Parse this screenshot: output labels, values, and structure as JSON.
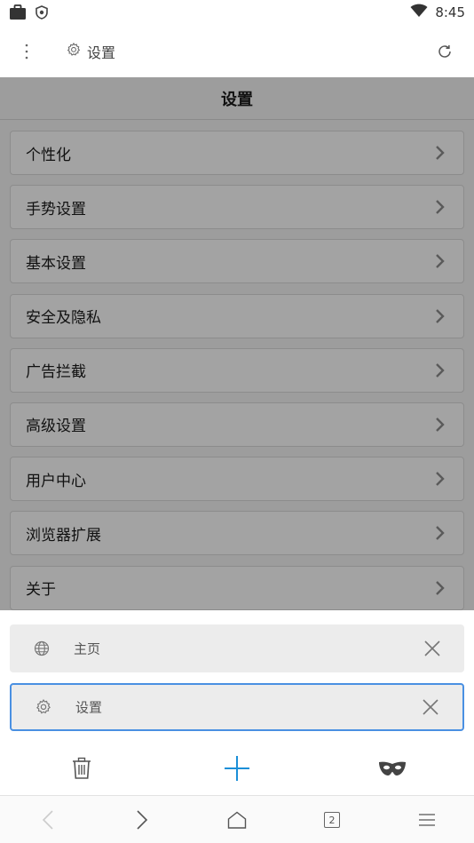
{
  "status_bar": {
    "time": "8:45",
    "icons": [
      "briefcase-icon",
      "shield-icon",
      "wifi-icon"
    ]
  },
  "top_bar": {
    "title": "设置",
    "icons": [
      "more-vertical-icon",
      "gear-icon",
      "reload-icon"
    ]
  },
  "page": {
    "header": "设置",
    "items": [
      {
        "label": "个性化"
      },
      {
        "label": "手势设置"
      },
      {
        "label": "基本设置"
      },
      {
        "label": "安全及隐私"
      },
      {
        "label": "广告拦截"
      },
      {
        "label": "高级设置"
      },
      {
        "label": "用户中心"
      },
      {
        "label": "浏览器扩展"
      },
      {
        "label": "关于"
      }
    ]
  },
  "tabs": [
    {
      "label": "主页",
      "icon": "globe-icon",
      "active": false
    },
    {
      "label": "设置",
      "icon": "gear-icon",
      "active": true
    }
  ],
  "tab_actions": [
    "trash-icon",
    "plus-icon",
    "incognito-mask-icon"
  ],
  "bottom_nav": {
    "tab_count": "2",
    "icons": [
      "back-icon",
      "forward-icon",
      "home-icon",
      "tabs-icon",
      "menu-icon"
    ]
  },
  "colors": {
    "accent": "#4a90e2",
    "overlay": "#9d9d9d",
    "card": "#ececec"
  }
}
